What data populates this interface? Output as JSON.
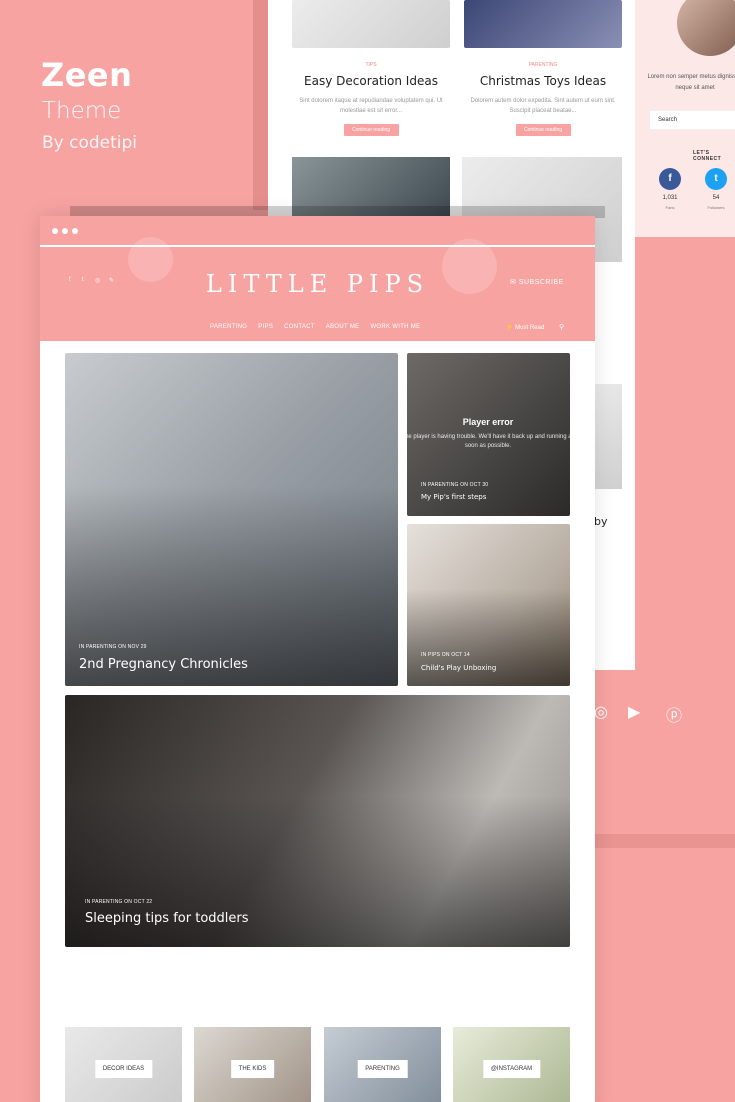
{
  "brand": {
    "title": "Zeen",
    "subtitle": "Theme",
    "byline": "By codetipi"
  },
  "back_cards": [
    {
      "category": "TIPS",
      "title": "Easy Decoration Ideas",
      "excerpt": "Sint dolorem itaque at repudiandae voluptatem qui. Ut molestiae est sit error...",
      "button": "Continue reading"
    },
    {
      "category": "PARENTING",
      "title": "Christmas Toys Ideas",
      "excerpt": "Dolorem autem dolor expedita. Sint autem ut eum sint. Suscipit placeat beatae...",
      "button": "Continue reading"
    }
  ],
  "sidebar": {
    "about_text": "Lorem non semper metus dignissim neque sit amet",
    "search_placeholder": "Search",
    "connect_label": "LET'S CONNECT",
    "social": [
      {
        "icon": "facebook-icon",
        "glyph": "f",
        "count": "1,031",
        "label": "Fans",
        "color": "#3b5998"
      },
      {
        "icon": "twitter-icon",
        "glyph": "t",
        "count": "54",
        "label": "Followers",
        "color": "#1da1f2"
      }
    ]
  },
  "peek_text": "by",
  "footer_icons": [
    {
      "name": "instagram-icon",
      "glyph": "◎"
    },
    {
      "name": "youtube-icon",
      "glyph": "▶"
    },
    {
      "name": "pinterest-icon",
      "glyph": "ⓟ"
    }
  ],
  "site": {
    "logo": "LITTLE PIPS",
    "subscribe": "SUBSCRIBE",
    "nav": [
      "PARENTING",
      "PIPS",
      "CONTACT",
      "ABOUT ME",
      "WORK WITH ME"
    ],
    "must_read": "Must Read",
    "header_social": [
      "f",
      "t",
      "◎",
      "✎"
    ]
  },
  "tiles": {
    "main": {
      "meta": "IN PARENTING ON NOV 29",
      "title": "2nd Pregnancy Chronicles"
    },
    "video": {
      "player_title": "Player error",
      "player_msg": "The player is having trouble. We'll have it back up and running as soon as possible.",
      "meta": "IN PARENTING ON OCT 30",
      "title": "My Pip's first steps"
    },
    "unbox": {
      "meta": "IN PIPS ON OCT 14",
      "title": "Child's Play Unboxing"
    },
    "sleep": {
      "meta": "IN PARENTING ON OCT 22",
      "title": "Sleeping tips for toddlers"
    }
  },
  "tags": [
    "DECOR IDEAS",
    "THE KIDS",
    "PARENTING",
    "@INSTAGRAM"
  ],
  "colors": {
    "accent": "#f7a3a1",
    "facebook": "#3b5998",
    "twitter": "#1da1f2"
  }
}
